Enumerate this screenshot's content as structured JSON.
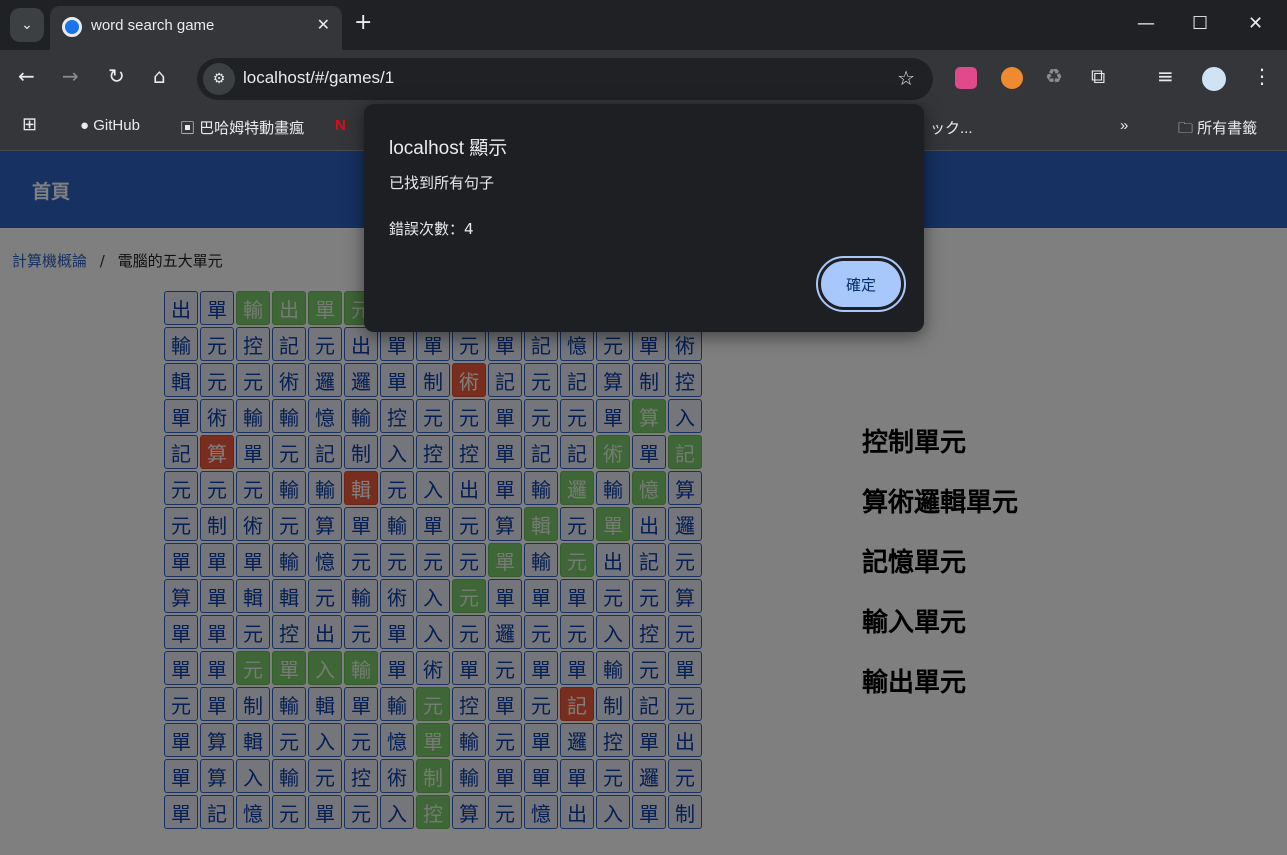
{
  "browser": {
    "tab_title": "word search game",
    "url": "localhost/#/games/1",
    "bookmarks": [
      "GitHub",
      "巴哈姆特動畫瘋",
      "ック...",
      "所有書籤"
    ]
  },
  "page": {
    "nav_home": "首頁",
    "breadcrumb_parent": "計算機概論",
    "breadcrumb_sep": "/",
    "breadcrumb_current": "電腦的五大單元"
  },
  "grid": {
    "rows": [
      "出單輸出單元單單元單單單算單輸",
      "輸元控記元出單單元單記憶元單術",
      "輯元元術邏邏單制術記元記算制控",
      "單術輸輸憶輸控元元單元元單算入",
      "記算單元記制入控控單記記術單記",
      "元元元輸輸輯元入出單輸邏輸憶算",
      "元制術元算單輸單元算輯元單出邏",
      "單單單輸憶元元元元單輸元出記元",
      "算單輯輯元輸術入元單單單元元算",
      "單單元控出元單入元邏元元入控元",
      "單單元單入輸單術單元單單輸元單",
      "元單制輸輯單輸元控單元記制記元",
      "單算輯元入元憶單輸元單邏控單出",
      "單算入輸元控術制輸單單單元邏元",
      "單記憶元單元入控算元憶出入單制"
    ],
    "found_cells": [
      [
        0,
        2
      ],
      [
        0,
        3
      ],
      [
        0,
        4
      ],
      [
        0,
        5
      ],
      [
        3,
        13
      ],
      [
        4,
        12
      ],
      [
        4,
        14
      ],
      [
        5,
        11
      ],
      [
        5,
        13
      ],
      [
        6,
        10
      ],
      [
        6,
        12
      ],
      [
        7,
        9
      ],
      [
        7,
        11
      ],
      [
        8,
        8
      ],
      [
        10,
        2
      ],
      [
        10,
        3
      ],
      [
        10,
        4
      ],
      [
        10,
        5
      ],
      [
        11,
        7
      ],
      [
        12,
        7
      ],
      [
        13,
        7
      ],
      [
        14,
        7
      ]
    ],
    "wrong_cells": [
      [
        2,
        8
      ],
      [
        4,
        1
      ],
      [
        5,
        5
      ],
      [
        11,
        11
      ]
    ]
  },
  "words": [
    "控制單元",
    "算術邏輯單元",
    "記憶單元",
    "輸入單元",
    "輸出單元"
  ],
  "dialog": {
    "title": "localhost 顯示",
    "line1": "已找到所有句子",
    "line2": "錯誤次數：4",
    "ok_label": "確定"
  },
  "colors": {
    "nav": "#2c62c4",
    "found": "#7fcc6f",
    "wrong": "#f05a3c"
  }
}
